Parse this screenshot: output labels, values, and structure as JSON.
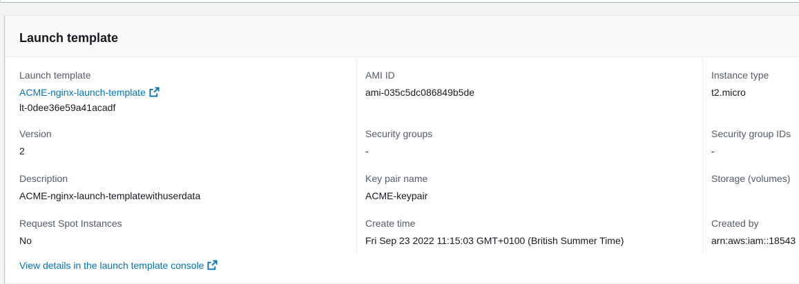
{
  "panel": {
    "title": "Launch template"
  },
  "fields": {
    "launch_template": {
      "label": "Launch template",
      "link_text": "ACME-nginx-launch-template",
      "id": "lt-0dee36e59a41acadf"
    },
    "ami_id": {
      "label": "AMI ID",
      "value": "ami-035c5dc086849b5de"
    },
    "instance_type": {
      "label": "Instance type",
      "value": "t2.micro"
    },
    "version": {
      "label": "Version",
      "value": "2"
    },
    "security_groups": {
      "label": "Security groups",
      "value": "-"
    },
    "security_group_ids": {
      "label": "Security group IDs",
      "value": "-"
    },
    "description": {
      "label": "Description",
      "value": "ACME-nginx-launch-templatewithuserdata"
    },
    "key_pair_name": {
      "label": "Key pair name",
      "value": "ACME-keypair"
    },
    "storage_volumes": {
      "label": "Storage (volumes)",
      "value": ""
    },
    "request_spot_instances": {
      "label": "Request Spot Instances",
      "value": "No"
    },
    "create_time": {
      "label": "Create time",
      "value": "Fri Sep 23 2022 11:15:03 GMT+0100 (British Summer Time)"
    },
    "created_by": {
      "label": "Created by",
      "value": "arn:aws:iam::18543"
    }
  },
  "footer": {
    "console_link": "View details in the launch template console"
  },
  "icons": {
    "external_link": "external-link-icon"
  },
  "colors": {
    "link": "#0073bb",
    "label": "#545b64",
    "text": "#16191f"
  }
}
